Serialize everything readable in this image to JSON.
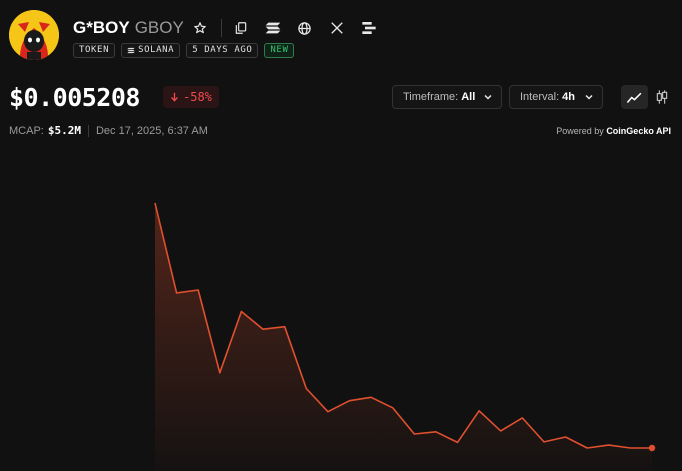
{
  "token": {
    "name": "G*BOY",
    "symbol": "GBOY",
    "tags": {
      "type": "TOKEN",
      "chain": "SOLANA",
      "age": "5 DAYS AGO",
      "badge": "NEW"
    }
  },
  "price": {
    "value": "$0.005208",
    "change": "-58%",
    "change_color": "#ef4a4a"
  },
  "controls": {
    "timeframe_label": "Timeframe:",
    "timeframe_value": "All",
    "interval_label": "Interval:",
    "interval_value": "4h"
  },
  "meta": {
    "mcap_label": "MCAP:",
    "mcap_value": "$5.2M",
    "date": "Dec 17, 2025, 6:37 AM",
    "powered_prefix": "Powered by",
    "powered_name": "CoinGecko API"
  },
  "icons": [
    "star-icon",
    "copy-icon",
    "solana-icon",
    "globe-icon",
    "x-icon",
    "menu-icon",
    "line-chart-icon",
    "candlestick-icon"
  ],
  "colors": {
    "line": "#e0502f",
    "accent_green": "#34c36a",
    "background": "#111111"
  },
  "chart_data": {
    "type": "area",
    "y_relative": [
      1.0,
      0.633,
      0.645,
      0.307,
      0.557,
      0.485,
      0.495,
      0.243,
      0.148,
      0.193,
      0.207,
      0.164,
      0.057,
      0.066,
      0.023,
      0.152,
      0.07,
      0.123,
      0.025,
      0.045,
      0.0,
      0.012,
      0.0,
      0.0
    ]
  }
}
